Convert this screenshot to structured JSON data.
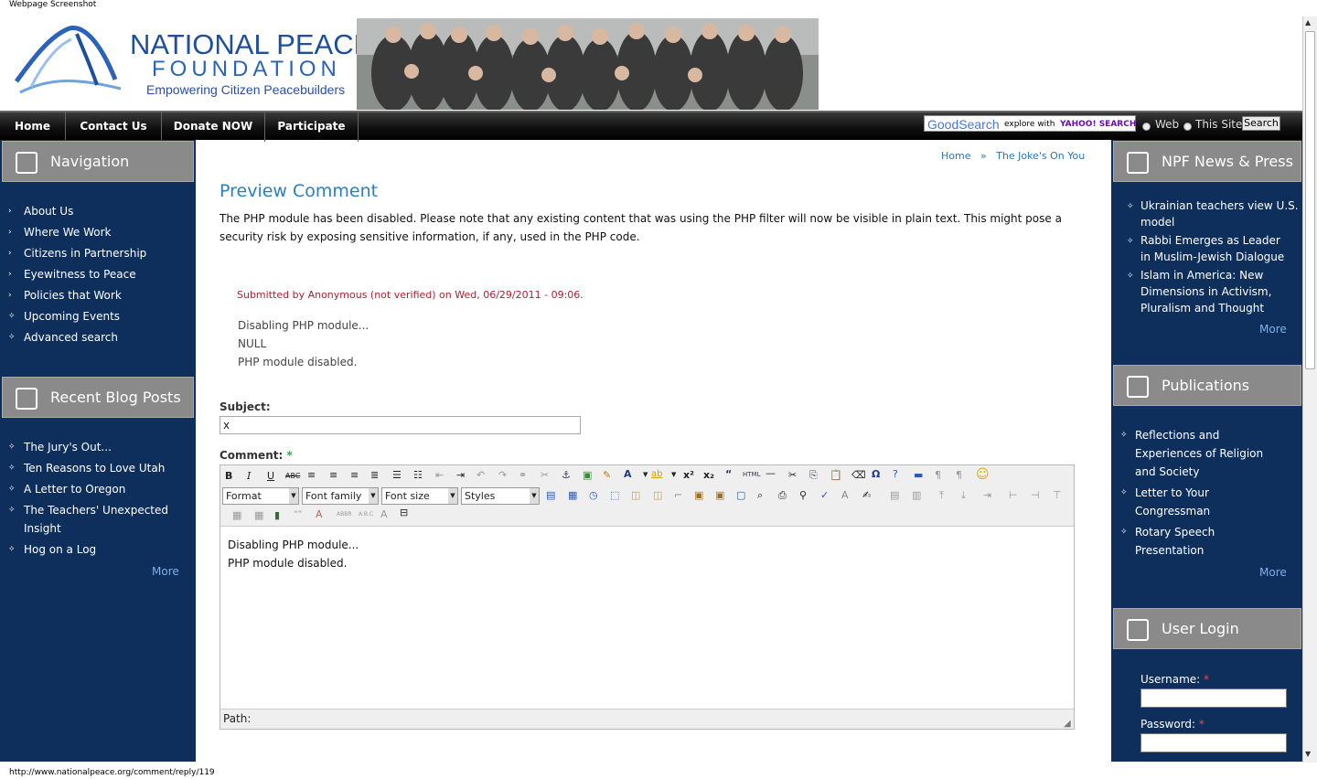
{
  "window": {
    "title": "Webpage Screenshot"
  },
  "status_url": "http://www.nationalpeace.org/comment/reply/119",
  "logo": {
    "line1": "NATIONAL PEACE",
    "line2": "FOUNDATION",
    "tagline": "Empowering Citizen Peacebuilders"
  },
  "nav": [
    "Home",
    "Contact Us",
    "Donate NOW",
    "Participate"
  ],
  "search": {
    "brand": "GoodSearch",
    "explore": "explore with",
    "yahoo": "YAHOO! SEARCH",
    "opt_web": "Web",
    "opt_site": "This Site",
    "button": "Search"
  },
  "left": {
    "navigation": {
      "title": "Navigation",
      "items": [
        "About Us",
        "Where We Work",
        "Citizens in Partnership",
        "Eyewitness to Peace",
        "Policies that Work",
        "Upcoming Events",
        "Advanced search"
      ]
    },
    "blog": {
      "title": "Recent Blog Posts",
      "items": [
        "The Jury's Out...",
        "Ten Reasons to Love Utah",
        "A Letter to Oregon",
        "The Teachers' Unexpected",
        "Insight",
        "Hog on a Log"
      ],
      "more": "More"
    }
  },
  "right": {
    "news": {
      "title": "NPF News & Press",
      "items": [
        [
          "Ukrainian teachers view U.S.",
          "model"
        ],
        [
          "Rabbi Emerges as Leader",
          "in Muslim-Jewish Dialogue"
        ],
        [
          "Islam in America: New",
          "Dimensions in Activism,",
          "Pluralism and Thought"
        ]
      ],
      "more": "More"
    },
    "pubs": {
      "title": "Publications",
      "items": [
        [
          "Reflections and",
          "Experiences of Religion",
          "and Society"
        ],
        [
          "Letter to Your",
          "Congressman"
        ],
        [
          "Rotary Speech",
          "Presentation"
        ]
      ],
      "more": "More"
    },
    "login": {
      "title": "User Login",
      "username_label": "Username:",
      "password_label": "Password:",
      "required": "*"
    }
  },
  "main": {
    "breadcrumb": {
      "home": "Home",
      "sep": "»",
      "current": "The Joke's On You"
    },
    "title": "Preview Comment",
    "notice": "The PHP module has been disabled. Please note that any existing content that was using the PHP filter will now be visible in plain text. This might pose a security risk by exposing sensitive information, if any, used in the PHP code.",
    "submitted": "Submitted by Anonymous (not verified) on Wed, 06/29/2011 - 09:06.",
    "comment_lines": [
      "Disabling PHP module...",
      "NULL",
      "PHP module disabled."
    ],
    "subject_label": "Subject:",
    "subject_value": "x",
    "comment_label": "Comment:",
    "required": "*",
    "editor": {
      "selects": [
        "Format",
        "Font family",
        "Font size",
        "Styles"
      ],
      "body": [
        "Disabling PHP module...",
        "PHP module disabled."
      ],
      "path_label": "Path:"
    }
  }
}
